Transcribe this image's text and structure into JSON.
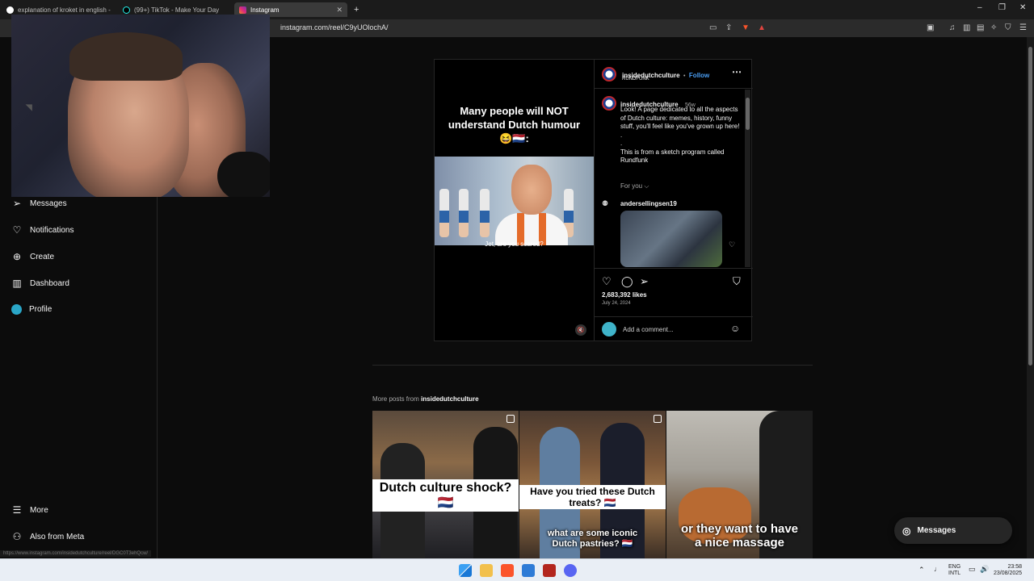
{
  "browser": {
    "tabs": [
      {
        "label": "explanation of kroket in english - Go"
      },
      {
        "label": "(99+) TikTok - Make Your Day"
      },
      {
        "label": "Instagram"
      }
    ],
    "new_tab": "+",
    "url": "instagram.com/reel/C9yUOlochA/",
    "window_controls": [
      "–",
      "❐",
      "✕"
    ]
  },
  "sidebar": {
    "items": [
      {
        "label": "Messages",
        "icon": "send-icon"
      },
      {
        "label": "Notifications",
        "icon": "heart-icon"
      },
      {
        "label": "Create",
        "icon": "plus-square-icon"
      },
      {
        "label": "Dashboard",
        "icon": "chart-icon"
      },
      {
        "label": "Profile",
        "icon": "avatar-icon"
      }
    ],
    "bottom": [
      {
        "label": "More",
        "icon": "menu-icon"
      },
      {
        "label": "Also from Meta",
        "icon": "meta-icon"
      }
    ],
    "status_url": "https://www.instagram.com/insidedutchculture/reel/DGC0T3ehQcw/"
  },
  "post": {
    "video_title": "Many people will NOT understand Dutch humour😆🇳🇱:",
    "subtitle": "Jet, are you scared?",
    "author": "insidedutchculture",
    "follow_sep": "•",
    "follow": "Follow",
    "audio": "RUNDFUNK",
    "caption_author": "insidedutchculture",
    "caption_age": "56w",
    "caption": "Look! A page dedicated to all the aspects of Dutch culture: memes, history, funny stuff, you'll feel like you've grown up here!\n.\n.\nThis is from a sketch program called Rundfunk",
    "for_you": "For you ⌵",
    "commenter": "andersellingsen19",
    "likes": "2,683,392 likes",
    "date": "July 24, 2024",
    "add_comment_placeholder": "Add a comment..."
  },
  "more_posts": {
    "prefix": "More posts from",
    "account": "insidedutchculture",
    "items": [
      {
        "text": "Dutch culture shock? 🇳🇱"
      },
      {
        "text": "Have you tried these Dutch treats? 🇳🇱",
        "bottom": "what are some iconic Dutch pastries? 🇳🇱"
      },
      {
        "text": "or they want to have a nice massage"
      }
    ]
  },
  "messages_button": "Messages",
  "taskbar": {
    "lang_top": "ENG",
    "lang_bottom": "INTL",
    "time": "23:58",
    "date": "23/08/2025"
  }
}
